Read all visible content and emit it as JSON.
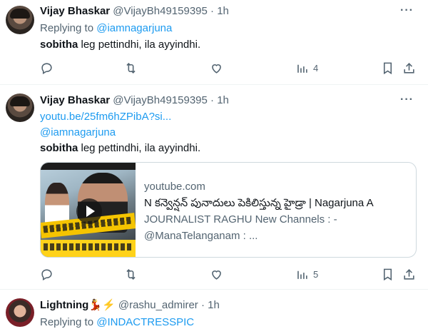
{
  "tweets": [
    {
      "name": "Vijay Bhaskar",
      "handle": "@VijayBh49159395",
      "sep": "·",
      "time": "1h",
      "replying_prefix": "Replying to ",
      "replying_to": "@iamnagarjuna",
      "text_bold": "sobitha",
      "text_rest": " leg pettindhi, ila ayyindhi.",
      "views": "4"
    },
    {
      "name": "Vijay Bhaskar",
      "handle": "@VijayBh49159395",
      "sep": "·",
      "time": "1h",
      "link": "youtu.be/25fm6hZPibA?si...",
      "mention": "@iamnagarjuna",
      "text_bold": "sobitha",
      "text_rest": " leg pettindhi, ila ayyindhi.",
      "card": {
        "domain": "youtube.com",
        "title": "N కన్వెన్షన్ పునాదులు పెకిలిస్తున్న హైడ్రా | Nagarjuna A",
        "desc_line1": "JOURNALIST RAGHU New Channels : -",
        "desc_line2": "@ManaTelanganam : ..."
      },
      "views": "5"
    },
    {
      "name": "Lightning",
      "name_emoji": "💃⚡",
      "handle": "@rashu_admirer",
      "sep": "·",
      "time": "1h",
      "replying_prefix": "Replying to ",
      "replying_to": "@INDACTRESSPIC"
    }
  ],
  "ui": {
    "more_glyph": "···",
    "icons": [
      "reply-icon",
      "retweet-icon",
      "like-icon",
      "views-icon",
      "bookmark-icon",
      "share-icon"
    ],
    "accent": "#1d9bf0",
    "muted": "#536471"
  }
}
